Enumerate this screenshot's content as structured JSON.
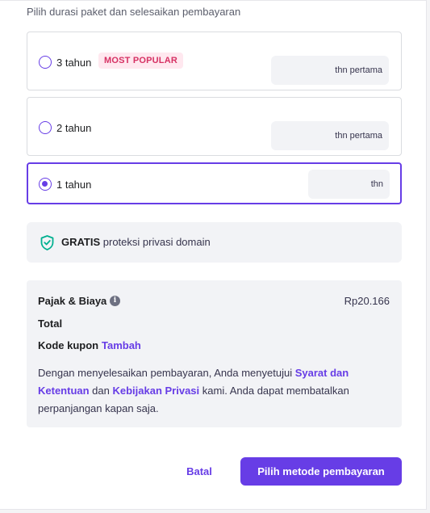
{
  "header": {
    "subtitle": "Pilih durasi paket dan selesaikan pembayaran"
  },
  "plans": [
    {
      "label": "3 tahun",
      "badge": "MOST POPULAR",
      "price_suffix": "thn pertama",
      "selected": false
    },
    {
      "label": "2 tahun",
      "badge": "",
      "price_suffix": "thn pertama",
      "selected": false
    },
    {
      "label": "1 tahun",
      "badge": "",
      "price_suffix": "thn",
      "selected": true
    }
  ],
  "privacy": {
    "bold": "GRATIS",
    "text": " proteksi privasi domain",
    "icon": "shield-check-icon"
  },
  "summary": {
    "tax_label": "Pajak & Biaya",
    "tax_value": "Rp20.166",
    "info_icon": "i",
    "total_label": "Total",
    "coupon_label": "Kode kupon",
    "coupon_link": "Tambah",
    "terms": {
      "part1": "Dengan menyelesaikan pembayaran, Anda menyetujui ",
      "link1": "Syarat dan Ketentuan",
      "part2": " dan ",
      "link2": "Kebijakan Privasi",
      "part3": " kami. Anda dapat membatalkan perpanjangan kapan saja."
    }
  },
  "actions": {
    "cancel": "Batal",
    "primary": "Pilih metode pembayaran"
  },
  "colors": {
    "accent": "#673de6",
    "badge_bg": "#ffe8ef",
    "badge_text": "#d63163",
    "shield": "#00b090"
  }
}
